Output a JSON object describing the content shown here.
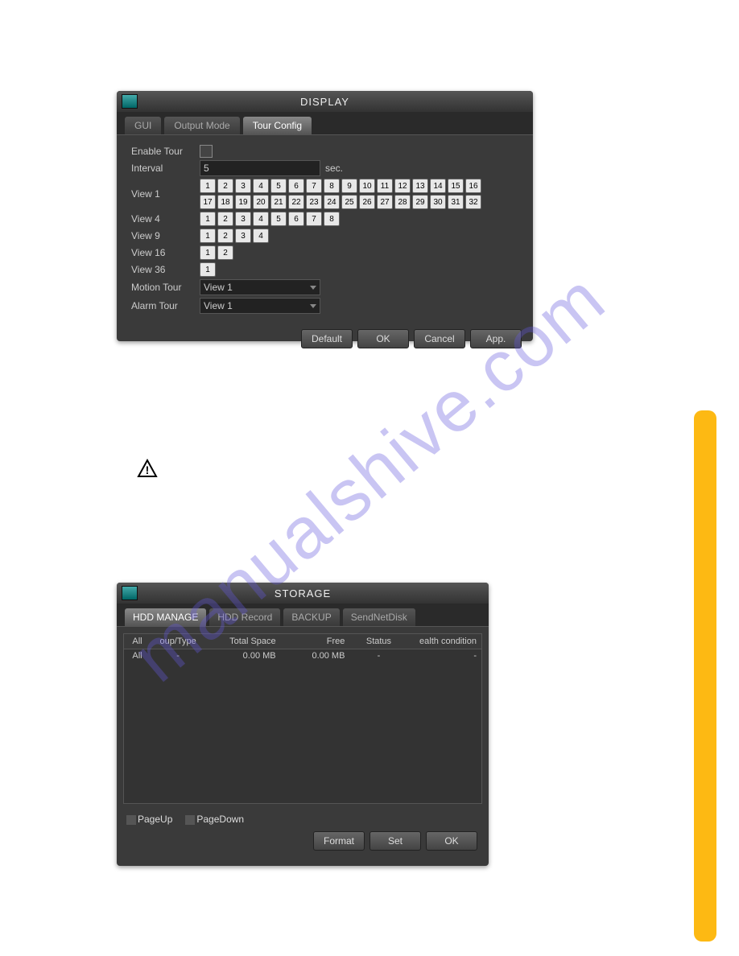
{
  "watermark": "manualshive.com",
  "display": {
    "title": "DISPLAY",
    "tabs": {
      "gui": "GUI",
      "output": "Output Mode",
      "tour": "Tour Config"
    },
    "fields": {
      "enable_tour": "Enable Tour",
      "interval": "Interval",
      "interval_value": "5",
      "interval_unit": "sec.",
      "view1": "View 1",
      "view4": "View 4",
      "view9": "View 9",
      "view16": "View 16",
      "view36": "View 36",
      "motion_tour": "Motion Tour",
      "alarm_tour": "Alarm Tour",
      "motion_value": "View 1",
      "alarm_value": "View 1"
    },
    "view1_buttons": [
      "1",
      "2",
      "3",
      "4",
      "5",
      "6",
      "7",
      "8",
      "9",
      "10",
      "11",
      "12",
      "13",
      "14",
      "15",
      "16",
      "17",
      "18",
      "19",
      "20",
      "21",
      "22",
      "23",
      "24",
      "25",
      "26",
      "27",
      "28",
      "29",
      "30",
      "31",
      "32"
    ],
    "view4_buttons": [
      "1",
      "2",
      "3",
      "4",
      "5",
      "6",
      "7",
      "8"
    ],
    "view9_buttons": [
      "1",
      "2",
      "3",
      "4"
    ],
    "view16_buttons": [
      "1",
      "2"
    ],
    "view36_buttons": [
      "1"
    ],
    "buttons": {
      "default": "Default",
      "ok": "OK",
      "cancel": "Cancel",
      "app": "App."
    }
  },
  "storage": {
    "title": "STORAGE",
    "tabs": {
      "hdd_manage": "HDD MANAGE",
      "hdd_record": "HDD Record",
      "backup": "BACKUP",
      "sendnetdisk": "SendNetDisk"
    },
    "headers": {
      "all": "All",
      "group": "oup/Type",
      "total": "Total Space",
      "free": "Free",
      "status": "Status",
      "health": "ealth condition"
    },
    "row": {
      "all": "All",
      "group": "-",
      "total": "0.00 MB",
      "free": "0.00 MB",
      "status": "-",
      "health": "-"
    },
    "pager": {
      "up": "PageUp",
      "down": "PageDown"
    },
    "buttons": {
      "format": "Format",
      "set": "Set",
      "ok": "OK"
    }
  }
}
